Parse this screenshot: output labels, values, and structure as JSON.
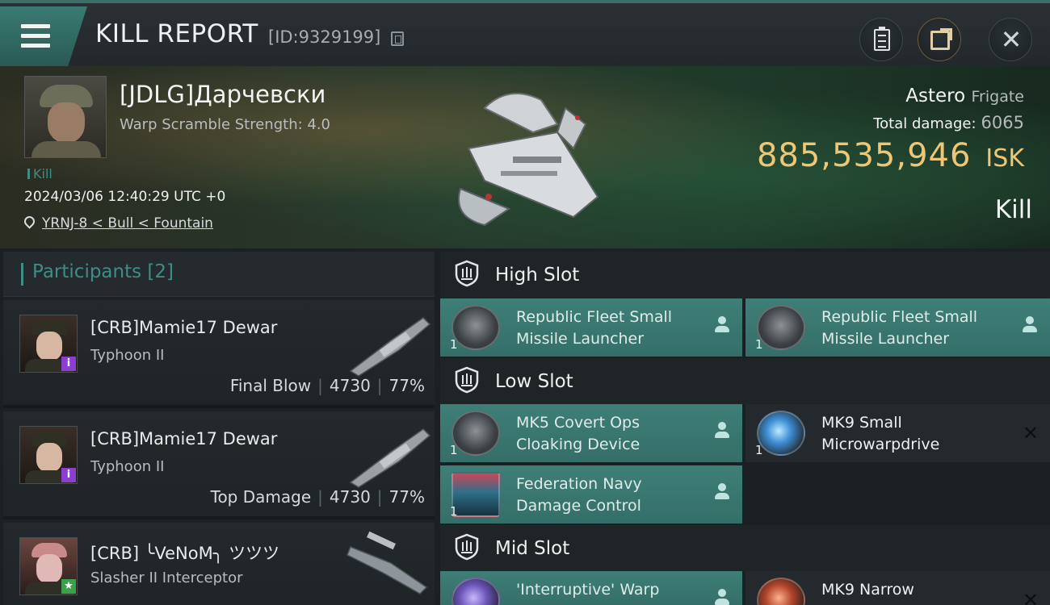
{
  "header": {
    "title": "KILL REPORT",
    "id_text": "[ID:9329199]"
  },
  "victim": {
    "name": "[JDLG]Дарчевски",
    "scramble_text": "Warp Scramble Strength: 4.0",
    "kill_tag": "Kill",
    "timestamp": "2024/03/06 12:40:29 UTC +0",
    "location": "YRNJ-8 < Bull < Fountain",
    "ship_name": "Astero",
    "ship_class": "Frigate",
    "total_damage_label": "Total damage:",
    "total_damage_value": "6065",
    "isk_value": "885,535,946",
    "isk_unit": "ISK",
    "result": "Kill"
  },
  "participants": {
    "label": "Participants [2]",
    "rows": [
      {
        "name": "[CRB]Mamie17 Dewar",
        "ship": "Typhoon II",
        "role": "Final Blow",
        "damage": "4730",
        "percent": "77%",
        "badge": "i",
        "badge_color": "#8a3fd0"
      },
      {
        "name": "[CRB]Mamie17 Dewar",
        "ship": "Typhoon II",
        "role": "Top Damage",
        "damage": "4730",
        "percent": "77%",
        "badge": "i",
        "badge_color": "#8a3fd0"
      },
      {
        "name": "[CRB] ╰VeNoM╮ ツツツ",
        "ship": "Slasher II Interceptor",
        "badge": "★",
        "badge_color": "#3aa04a"
      }
    ]
  },
  "slots": {
    "high": {
      "label": "High Slot",
      "modules": [
        {
          "name_line1": "Republic Fleet Small",
          "name_line2": "Missile Launcher",
          "qty": "1",
          "status": "fitted"
        },
        {
          "name_line1": "Republic Fleet Small",
          "name_line2": "Missile Launcher",
          "qty": "1",
          "status": "fitted"
        }
      ]
    },
    "low": {
      "label": "Low Slot",
      "modules": [
        {
          "name_line1": "MK5 Covert Ops",
          "name_line2": "Cloaking Device",
          "qty": "1",
          "status": "fitted"
        },
        {
          "name_line1": "MK9 Small",
          "name_line2": "Microwarpdrive",
          "qty": "1",
          "status": "destroyed"
        },
        {
          "name_line1": "Federation Navy",
          "name_line2": "Damage Control",
          "qty": "1",
          "status": "fitted"
        }
      ]
    },
    "mid": {
      "label": "Mid Slot",
      "modules": [
        {
          "name_line1": "'Interruptive' Warp",
          "status": "fitted"
        },
        {
          "name_line1": "MK9 Narrow",
          "status": "destroyed"
        }
      ]
    }
  },
  "colors": {
    "accent_teal": "#3e8d86",
    "isk_gold": "#efc774",
    "module_active": "#3e7f78"
  }
}
